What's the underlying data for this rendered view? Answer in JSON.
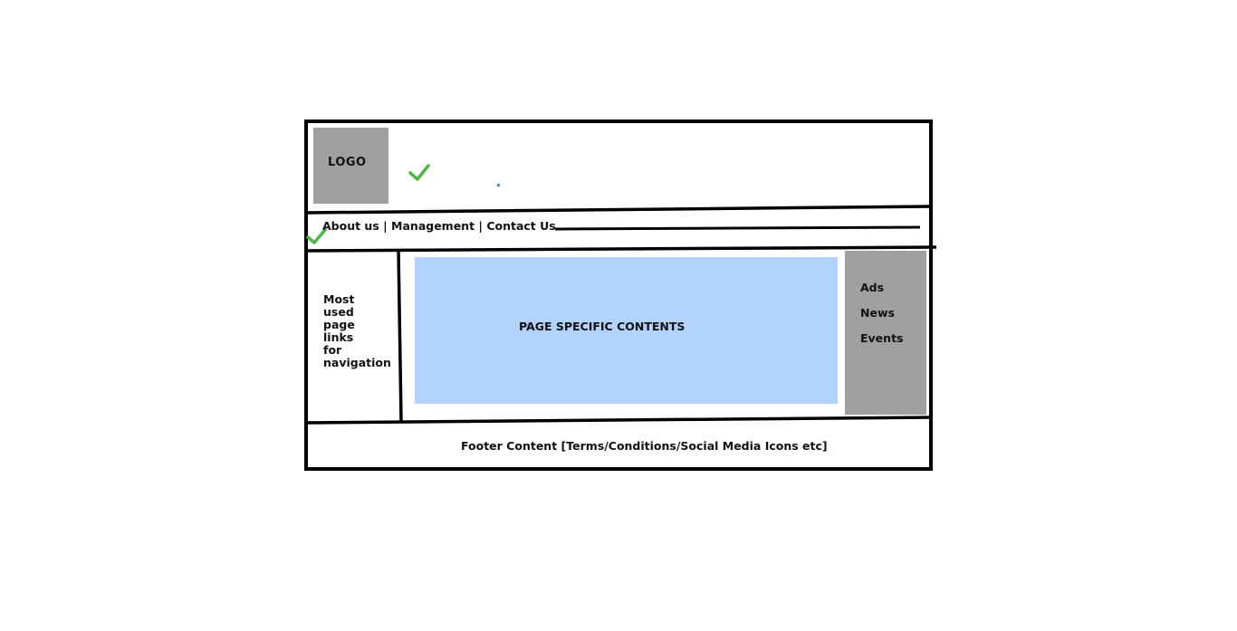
{
  "header": {
    "logo_label": "LOGO"
  },
  "nav": {
    "links_text": "About us | Management | Contact Us"
  },
  "left_sidebar": {
    "lines": [
      "Most",
      "used",
      "page",
      "links",
      "for",
      "navigation"
    ]
  },
  "main": {
    "content_label": "PAGE SPECIFIC CONTENTS"
  },
  "right_sidebar": {
    "items": [
      "Ads",
      "News",
      "Events"
    ]
  },
  "footer": {
    "text": "Footer Content [Terms/Conditions/Social Media Icons etc]"
  },
  "colors": {
    "outline": "#000000",
    "logo_box": "#a0a0a0",
    "content_box": "#b2d3fd",
    "sidebar_box": "#a0a0a0",
    "check_mark": "#4cb648",
    "dot": "#3a8fd8"
  }
}
